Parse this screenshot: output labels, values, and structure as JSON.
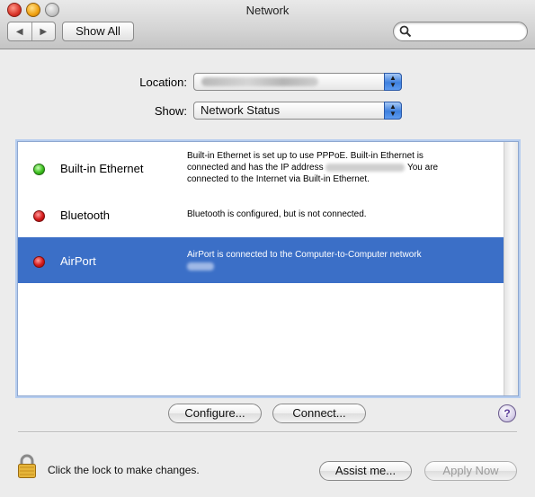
{
  "window": {
    "title": "Network"
  },
  "toolbar": {
    "back_icon": "◀",
    "forward_icon": "▶",
    "show_all_label": "Show All",
    "search": {
      "value": "",
      "placeholder": ""
    }
  },
  "location": {
    "label": "Location:",
    "value": ""
  },
  "show": {
    "label": "Show:",
    "value": "Network Status"
  },
  "services": [
    {
      "name": "Built-in Ethernet",
      "status_color": "green",
      "desc_line1": "Built-in Ethernet is set up to use PPPoE. Built-in Ethernet is",
      "desc_line2a": "connected and has the IP address",
      "desc_line2b": "You are",
      "desc_line3": "connected to the Internet via Built-in Ethernet."
    },
    {
      "name": "Bluetooth",
      "status_color": "red",
      "desc_line1": "Bluetooth is configured, but is not connected."
    },
    {
      "name": "AirPort",
      "status_color": "red",
      "selected": true,
      "desc_line1": "AirPort is connected to the Computer-to-Computer network"
    }
  ],
  "buttons": {
    "configure": "Configure...",
    "connect": "Connect...",
    "help": "?",
    "assist": "Assist me...",
    "apply": "Apply Now"
  },
  "lock": {
    "text": "Click the lock to make changes."
  },
  "colors": {
    "selection": "#3b6fc7",
    "status_green": "#3cbf1e",
    "status_red": "#d51919"
  }
}
